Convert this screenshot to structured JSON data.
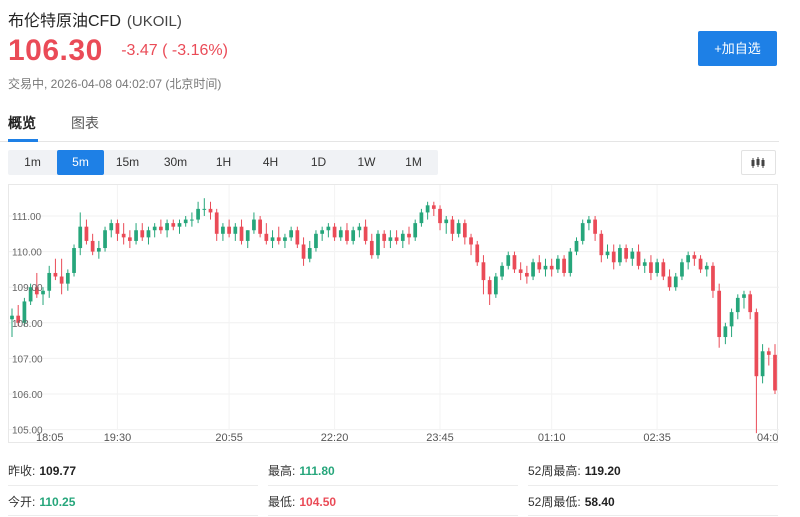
{
  "header": {
    "name": "布伦特原油CFD",
    "code": "(UKOIL)",
    "price": "106.30",
    "change": "-3.47 ( -3.16%)",
    "status": "交易中, 2026-04-08 04:02:07 (北京时间)",
    "add_button": "+加自选"
  },
  "tabs": [
    {
      "label": "概览",
      "active": true
    },
    {
      "label": "图表",
      "active": false
    }
  ],
  "periods": [
    {
      "label": "1m",
      "active": false
    },
    {
      "label": "5m",
      "active": true
    },
    {
      "label": "15m",
      "active": false
    },
    {
      "label": "30m",
      "active": false
    },
    {
      "label": "1H",
      "active": false
    },
    {
      "label": "4H",
      "active": false
    },
    {
      "label": "1D",
      "active": false
    },
    {
      "label": "1W",
      "active": false
    },
    {
      "label": "1M",
      "active": false
    }
  ],
  "chart_type_icon": "candlestick-chart-icon",
  "stats": {
    "prev_close": {
      "label": "昨收:",
      "value": "109.77"
    },
    "open": {
      "label": "今开:",
      "value": "110.25"
    },
    "high": {
      "label": "最高:",
      "value": "111.80"
    },
    "low": {
      "label": "最低:",
      "value": "104.50"
    },
    "high_52w": {
      "label": "52周最高:",
      "value": "119.20"
    },
    "low_52w": {
      "label": "52周最低:",
      "value": "58.40"
    }
  },
  "colors": {
    "up": "#26a67b",
    "down": "#ea4b57",
    "accent": "#1e80e6"
  },
  "chart_data": {
    "type": "candlestick",
    "y_ticks": [
      "111.00",
      "110.00",
      "109.00",
      "108.00",
      "107.00",
      "106.00",
      "105.00"
    ],
    "x_ticks": [
      "18:05",
      "19:30",
      "20:55",
      "22:20",
      "23:45",
      "01:10",
      "02:35",
      "04:0"
    ],
    "ylim": [
      104.75,
      111.3
    ],
    "grid": true,
    "up_color": "#26a67b",
    "down_color": "#ea4b57",
    "candles": [
      [
        108.1,
        108.4,
        107.6,
        108.2
      ],
      [
        108.2,
        108.5,
        107.9,
        108.0
      ],
      [
        108.0,
        108.7,
        107.9,
        108.6
      ],
      [
        108.6,
        109.1,
        108.5,
        109.0
      ],
      [
        109.0,
        109.4,
        108.7,
        108.8
      ],
      [
        108.8,
        109.0,
        108.5,
        108.9
      ],
      [
        108.9,
        109.6,
        108.7,
        109.4
      ],
      [
        109.4,
        109.8,
        109.2,
        109.3
      ],
      [
        109.3,
        109.8,
        108.8,
        109.1
      ],
      [
        109.1,
        109.5,
        108.9,
        109.4
      ],
      [
        109.4,
        110.2,
        109.3,
        110.1
      ],
      [
        110.1,
        111.1,
        109.9,
        110.7
      ],
      [
        110.7,
        110.9,
        110.2,
        110.3
      ],
      [
        110.3,
        110.5,
        109.9,
        110.0
      ],
      [
        110.0,
        110.3,
        109.8,
        110.1
      ],
      [
        110.1,
        110.7,
        110.0,
        110.6
      ],
      [
        110.6,
        110.9,
        110.4,
        110.8
      ],
      [
        110.8,
        110.9,
        110.3,
        110.5
      ],
      [
        110.5,
        110.8,
        110.2,
        110.4
      ],
      [
        110.4,
        110.6,
        110.1,
        110.3
      ],
      [
        110.3,
        110.8,
        110.2,
        110.6
      ],
      [
        110.6,
        110.8,
        110.3,
        110.4
      ],
      [
        110.4,
        110.7,
        110.2,
        110.6
      ],
      [
        110.6,
        110.8,
        110.4,
        110.7
      ],
      [
        110.7,
        110.9,
        110.5,
        110.6
      ],
      [
        110.6,
        110.9,
        110.4,
        110.8
      ],
      [
        110.8,
        110.9,
        110.6,
        110.7
      ],
      [
        110.7,
        110.9,
        110.5,
        110.8
      ],
      [
        110.8,
        111.0,
        110.7,
        110.9
      ],
      [
        110.9,
        111.1,
        110.7,
        110.9
      ],
      [
        110.9,
        111.4,
        110.8,
        111.2
      ],
      [
        111.2,
        111.5,
        111.0,
        111.2
      ],
      [
        111.2,
        111.4,
        110.9,
        111.1
      ],
      [
        111.1,
        111.2,
        110.3,
        110.5
      ],
      [
        110.5,
        110.8,
        110.3,
        110.7
      ],
      [
        110.7,
        110.9,
        110.4,
        110.5
      ],
      [
        110.5,
        110.8,
        110.3,
        110.7
      ],
      [
        110.7,
        110.9,
        110.2,
        110.3
      ],
      [
        110.3,
        110.6,
        110.1,
        110.6
      ],
      [
        110.6,
        111.1,
        110.5,
        110.9
      ],
      [
        110.9,
        111.0,
        110.4,
        110.5
      ],
      [
        110.5,
        110.8,
        110.2,
        110.3
      ],
      [
        110.3,
        110.6,
        110.1,
        110.4
      ],
      [
        110.4,
        110.7,
        110.2,
        110.3
      ],
      [
        110.3,
        110.5,
        110.1,
        110.4
      ],
      [
        110.4,
        110.7,
        110.3,
        110.6
      ],
      [
        110.6,
        110.7,
        110.1,
        110.2
      ],
      [
        110.2,
        110.4,
        109.6,
        109.8
      ],
      [
        109.8,
        110.3,
        109.7,
        110.1
      ],
      [
        110.1,
        110.6,
        110.0,
        110.5
      ],
      [
        110.5,
        110.7,
        110.3,
        110.6
      ],
      [
        110.6,
        110.8,
        110.4,
        110.7
      ],
      [
        110.7,
        110.8,
        110.3,
        110.4
      ],
      [
        110.4,
        110.7,
        110.3,
        110.6
      ],
      [
        110.6,
        110.8,
        110.2,
        110.3
      ],
      [
        110.3,
        110.7,
        110.2,
        110.6
      ],
      [
        110.6,
        110.8,
        110.4,
        110.7
      ],
      [
        110.7,
        110.9,
        110.2,
        110.3
      ],
      [
        110.3,
        110.5,
        109.8,
        109.9
      ],
      [
        109.9,
        110.6,
        109.8,
        110.5
      ],
      [
        110.5,
        110.6,
        110.1,
        110.3
      ],
      [
        110.3,
        110.6,
        110.1,
        110.4
      ],
      [
        110.4,
        110.6,
        110.2,
        110.3
      ],
      [
        110.3,
        110.6,
        110.1,
        110.5
      ],
      [
        110.5,
        110.7,
        110.2,
        110.4
      ],
      [
        110.4,
        110.9,
        110.3,
        110.8
      ],
      [
        110.8,
        111.2,
        110.7,
        111.1
      ],
      [
        111.1,
        111.4,
        110.9,
        111.3
      ],
      [
        111.3,
        111.4,
        111.0,
        111.2
      ],
      [
        111.2,
        111.3,
        110.6,
        110.8
      ],
      [
        110.8,
        111.0,
        110.5,
        110.9
      ],
      [
        110.9,
        111.0,
        110.3,
        110.5
      ],
      [
        110.5,
        110.9,
        110.4,
        110.8
      ],
      [
        110.8,
        110.9,
        110.2,
        110.4
      ],
      [
        110.4,
        110.5,
        109.9,
        110.2
      ],
      [
        110.2,
        110.3,
        109.6,
        109.7
      ],
      [
        109.7,
        109.9,
        108.8,
        109.2
      ],
      [
        109.2,
        109.3,
        108.5,
        108.8
      ],
      [
        108.8,
        109.4,
        108.7,
        109.3
      ],
      [
        109.3,
        109.7,
        109.2,
        109.6
      ],
      [
        109.6,
        110.0,
        109.5,
        109.9
      ],
      [
        109.9,
        110.0,
        109.4,
        109.5
      ],
      [
        109.5,
        109.7,
        109.2,
        109.4
      ],
      [
        109.4,
        109.6,
        109.1,
        109.3
      ],
      [
        109.3,
        109.8,
        109.2,
        109.7
      ],
      [
        109.7,
        109.9,
        109.4,
        109.5
      ],
      [
        109.5,
        109.8,
        109.3,
        109.6
      ],
      [
        109.6,
        109.8,
        109.3,
        109.5
      ],
      [
        109.5,
        109.9,
        109.4,
        109.8
      ],
      [
        109.8,
        109.9,
        109.3,
        109.4
      ],
      [
        109.4,
        110.1,
        109.3,
        110.0
      ],
      [
        110.0,
        110.4,
        109.9,
        110.3
      ],
      [
        110.3,
        110.9,
        110.2,
        110.8
      ],
      [
        110.8,
        111.0,
        110.6,
        110.9
      ],
      [
        110.9,
        111.0,
        110.3,
        110.5
      ],
      [
        110.5,
        110.6,
        109.7,
        109.9
      ],
      [
        109.9,
        110.2,
        109.8,
        110.0
      ],
      [
        110.0,
        110.2,
        109.5,
        109.7
      ],
      [
        109.7,
        110.2,
        109.6,
        110.1
      ],
      [
        110.1,
        110.2,
        109.7,
        109.8
      ],
      [
        109.8,
        110.1,
        109.6,
        110.0
      ],
      [
        110.0,
        110.2,
        109.5,
        109.6
      ],
      [
        109.6,
        109.8,
        109.4,
        109.7
      ],
      [
        109.7,
        109.9,
        109.2,
        109.4
      ],
      [
        109.4,
        109.8,
        109.3,
        109.7
      ],
      [
        109.7,
        109.8,
        109.2,
        109.3
      ],
      [
        109.3,
        109.5,
        108.9,
        109.0
      ],
      [
        109.0,
        109.4,
        108.9,
        109.3
      ],
      [
        109.3,
        109.8,
        109.2,
        109.7
      ],
      [
        109.7,
        110.0,
        109.5,
        109.9
      ],
      [
        109.9,
        110.0,
        109.6,
        109.8
      ],
      [
        109.8,
        109.9,
        109.4,
        109.5
      ],
      [
        109.5,
        109.7,
        109.3,
        109.6
      ],
      [
        109.6,
        109.7,
        108.7,
        108.9
      ],
      [
        108.9,
        109.1,
        107.3,
        107.6
      ],
      [
        107.6,
        108.0,
        107.4,
        107.9
      ],
      [
        107.9,
        108.4,
        107.6,
        108.3
      ],
      [
        108.3,
        108.8,
        108.1,
        108.7
      ],
      [
        108.7,
        108.9,
        108.4,
        108.8
      ],
      [
        108.8,
        108.9,
        108.1,
        108.3
      ],
      [
        108.3,
        108.4,
        104.9,
        106.5
      ],
      [
        106.5,
        107.4,
        106.3,
        107.2
      ],
      [
        107.2,
        107.3,
        106.8,
        107.1
      ],
      [
        107.1,
        107.4,
        106.0,
        106.1
      ]
    ]
  }
}
